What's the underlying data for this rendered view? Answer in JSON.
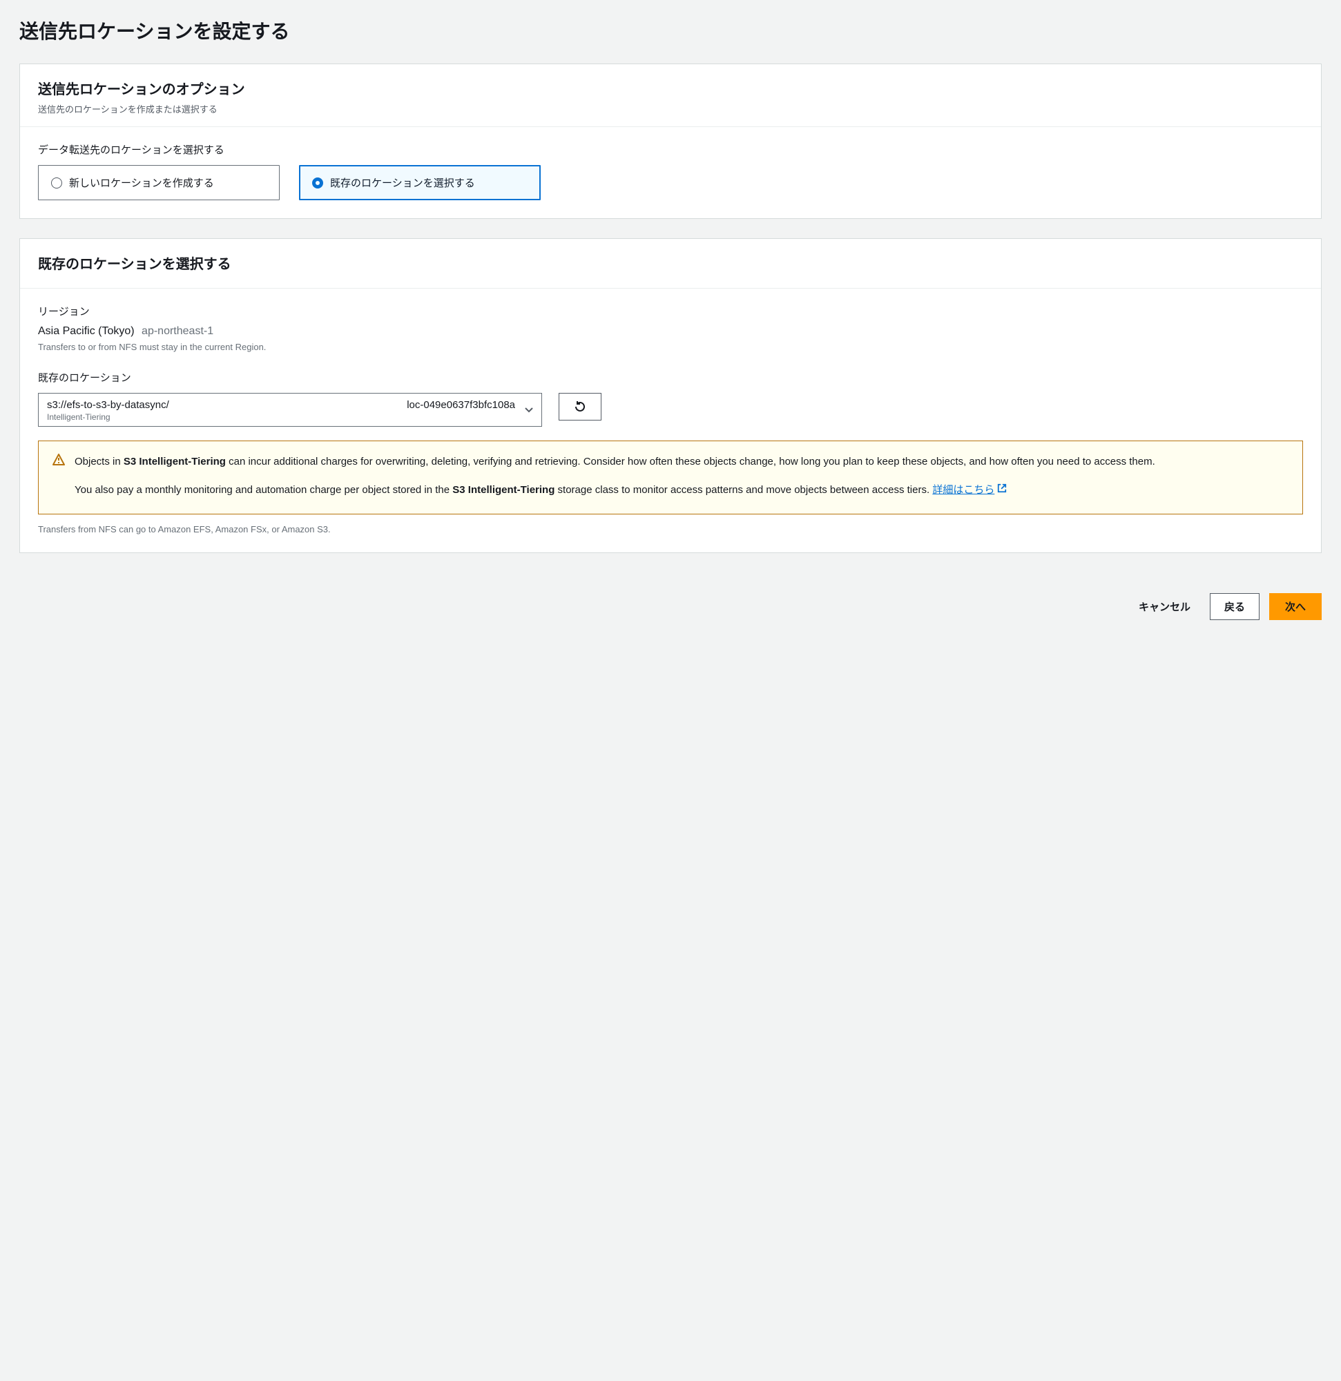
{
  "page": {
    "title": "送信先ロケーションを設定する"
  },
  "options_panel": {
    "title": "送信先ロケーションのオプション",
    "desc": "送信先のロケーションを作成または選択する",
    "choose_label": "データ転送先のロケーションを選択する",
    "radio_create": "新しいロケーションを作成する",
    "radio_existing": "既存のロケーションを選択する"
  },
  "existing_panel": {
    "title": "既存のロケーションを選択する",
    "region_label": "リージョン",
    "region_name": "Asia Pacific (Tokyo)",
    "region_code": "ap-northeast-1",
    "region_helper": "Transfers to or from NFS must stay in the current Region.",
    "location_label": "既存のロケーション",
    "dropdown": {
      "path": "s3://efs-to-s3-by-datasync/",
      "id": "loc-049e0637f3bfc108a",
      "storage_class": "Intelligent-Tiering"
    },
    "alert": {
      "p1_pre": "Objects in ",
      "p1_bold": "S3 Intelligent-Tiering",
      "p1_post": " can incur additional charges for overwriting, deleting, verifying and retrieving. Consider how often these objects change, how long you plan to keep these objects, and how often you need to access them.",
      "p2_pre": "You also pay a monthly monitoring and automation charge per object stored in the ",
      "p2_bold": "S3 Intelligent-Tiering",
      "p2_post": " storage class to monitor access patterns and move objects between access tiers. ",
      "link": "詳細はこちら"
    },
    "footer_note": "Transfers from NFS can go to Amazon EFS, Amazon FSx, or Amazon S3."
  },
  "actions": {
    "cancel": "キャンセル",
    "back": "戻る",
    "next": "次へ"
  }
}
